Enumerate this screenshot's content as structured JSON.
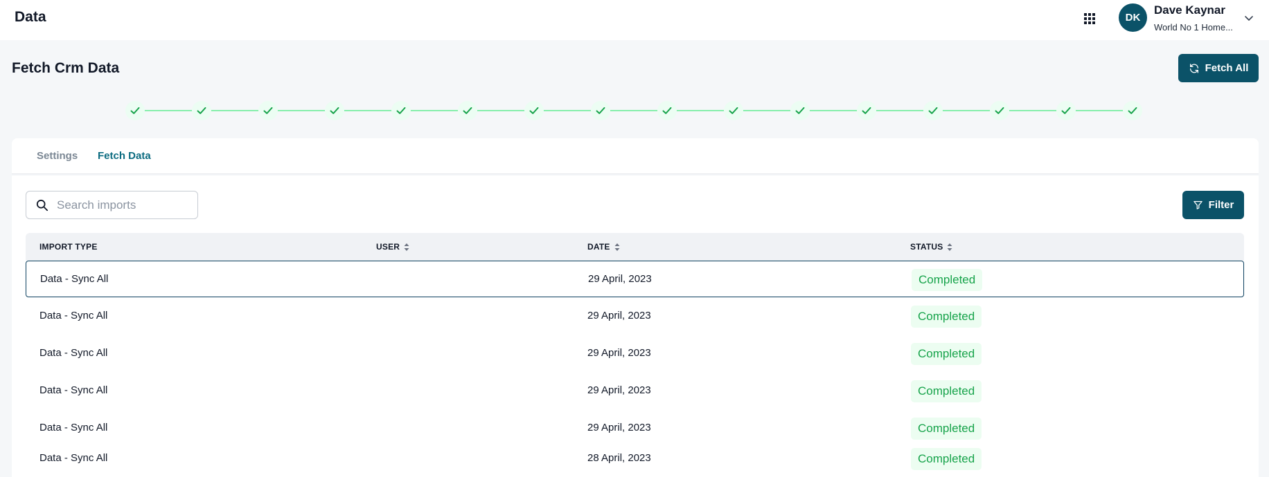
{
  "header": {
    "app_title": "Data",
    "apps_icon": "grid-apps-icon",
    "user": {
      "initials": "DK",
      "name": "Dave Kaynar",
      "org": "World No 1 Home..."
    }
  },
  "page": {
    "title": "Fetch Crm Data",
    "fetch_all_label": "Fetch All",
    "stepper_steps": 16,
    "stepper_state": "all-completed"
  },
  "tabs": [
    {
      "label": "Settings",
      "active": false
    },
    {
      "label": "Fetch Data",
      "active": true
    }
  ],
  "search": {
    "placeholder": "Search imports",
    "value": ""
  },
  "filter_label": "Filter",
  "table": {
    "columns": [
      "IMPORT TYPE",
      "USER",
      "DATE",
      "STATUS"
    ],
    "rows": [
      {
        "type": "Data - Sync All",
        "user": "",
        "date": "29 April, 2023",
        "status": "Completed"
      },
      {
        "type": "Data - Sync All",
        "user": "",
        "date": "29 April, 2023",
        "status": "Completed"
      },
      {
        "type": "Data - Sync All",
        "user": "",
        "date": "29 April, 2023",
        "status": "Completed"
      },
      {
        "type": "Data - Sync All",
        "user": "",
        "date": "29 April, 2023",
        "status": "Completed"
      },
      {
        "type": "Data - Sync All",
        "user": "",
        "date": "29 April, 2023",
        "status": "Completed"
      },
      {
        "type": "Data - Sync All",
        "user": "",
        "date": "28 April, 2023",
        "status": "Completed"
      }
    ]
  },
  "colors": {
    "primary": "#0b5268",
    "success": "#16a34a",
    "success_bg": "#ecfdf1",
    "step_line": "#86efac"
  }
}
